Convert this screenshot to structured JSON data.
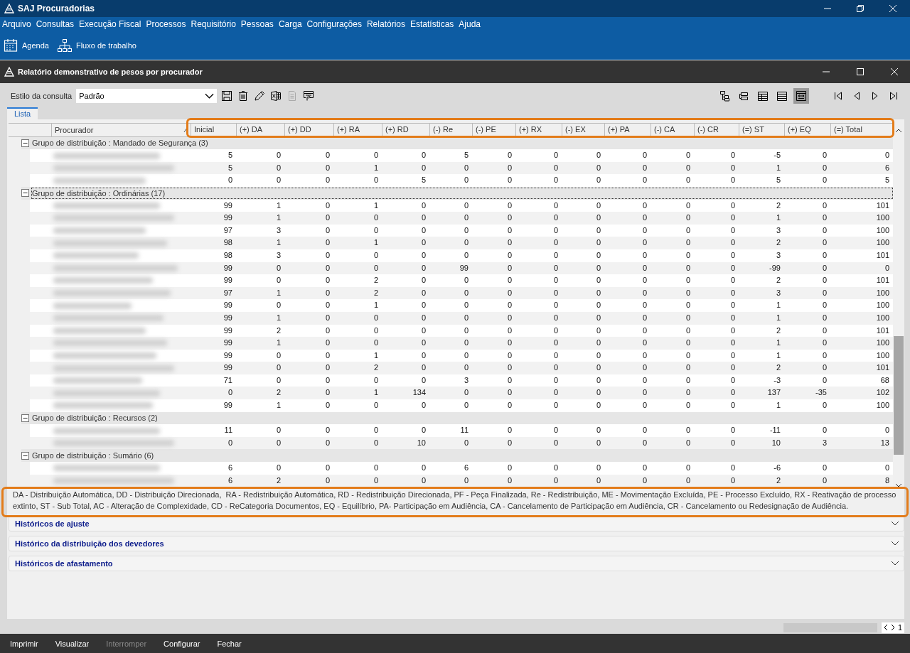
{
  "app": {
    "title": "SAJ Procuradorias"
  },
  "menu": [
    "Arquivo",
    "Consultas",
    "Execução Fiscal",
    "Processos",
    "Requisitório",
    "Pessoas",
    "Carga",
    "Configurações",
    "Relatórios",
    "Estatísticas",
    "Ajuda"
  ],
  "toolbar": [
    {
      "label": "Agenda",
      "kind": "calendar"
    },
    {
      "label": "Fluxo de trabalho",
      "kind": "flow"
    }
  ],
  "window": {
    "title": "Relatório demonstrativo de pesos por procurador"
  },
  "query": {
    "label": "Estilo da consulta",
    "value": "Padrão"
  },
  "query_tools": [
    {
      "kind": "save",
      "disabled": false
    },
    {
      "kind": "delete",
      "disabled": false
    },
    {
      "kind": "edit",
      "disabled": false
    },
    {
      "kind": "excel",
      "disabled": false
    },
    {
      "kind": "copy",
      "disabled": true
    },
    {
      "kind": "export",
      "disabled": false
    }
  ],
  "view_buttons": [
    {
      "kind": "tree",
      "selected": false
    },
    {
      "kind": "group",
      "selected": false
    },
    {
      "kind": "grid",
      "selected": false
    },
    {
      "kind": "list",
      "selected": false
    },
    {
      "kind": "fit",
      "selected": true
    }
  ],
  "nav_buttons": [
    {
      "kind": "first"
    },
    {
      "kind": "prev"
    },
    {
      "kind": "next"
    },
    {
      "kind": "last"
    }
  ],
  "tabs": [
    {
      "label": "Lista",
      "selected": true
    }
  ],
  "table": {
    "columns": [
      "Procurador",
      "Inicial",
      "(+) DA",
      "(+) DD",
      "(+) RA",
      "(+) RD",
      "(-) Re",
      "(-) PE",
      "(+) RX",
      "(-) EX",
      "(+) PA",
      "(-) CA",
      "(-) CR",
      "(=) ST",
      "(+) EQ",
      "(=) Total"
    ],
    "groups": [
      {
        "title": "Grupo de distribuição : Mandado de Segurança (3)",
        "expanded": true,
        "selected": false,
        "rows": [
          [
            "5",
            "0",
            "0",
            "0",
            "0",
            "5",
            "0",
            "0",
            "0",
            "0",
            "0",
            "0",
            "-5",
            "0",
            "0"
          ],
          [
            "5",
            "0",
            "0",
            "1",
            "0",
            "0",
            "0",
            "0",
            "0",
            "0",
            "0",
            "0",
            "1",
            "0",
            "6"
          ],
          [
            "0",
            "0",
            "0",
            "0",
            "5",
            "0",
            "0",
            "0",
            "0",
            "0",
            "0",
            "0",
            "5",
            "0",
            "5"
          ]
        ]
      },
      {
        "title": "Grupo de distribuição : Ordinárias (17)",
        "expanded": true,
        "selected": true,
        "rows": [
          [
            "99",
            "1",
            "0",
            "1",
            "0",
            "0",
            "0",
            "0",
            "0",
            "0",
            "0",
            "0",
            "2",
            "0",
            "101"
          ],
          [
            "99",
            "1",
            "0",
            "0",
            "0",
            "0",
            "0",
            "0",
            "0",
            "0",
            "0",
            "0",
            "1",
            "0",
            "100"
          ],
          [
            "97",
            "3",
            "0",
            "0",
            "0",
            "0",
            "0",
            "0",
            "0",
            "0",
            "0",
            "0",
            "3",
            "0",
            "100"
          ],
          [
            "98",
            "1",
            "0",
            "1",
            "0",
            "0",
            "0",
            "0",
            "0",
            "0",
            "0",
            "0",
            "2",
            "0",
            "100"
          ],
          [
            "98",
            "3",
            "0",
            "0",
            "0",
            "0",
            "0",
            "0",
            "0",
            "0",
            "0",
            "0",
            "3",
            "0",
            "101"
          ],
          [
            "99",
            "0",
            "0",
            "0",
            "0",
            "99",
            "0",
            "0",
            "0",
            "0",
            "0",
            "0",
            "-99",
            "0",
            "0"
          ],
          [
            "99",
            "0",
            "0",
            "2",
            "0",
            "0",
            "0",
            "0",
            "0",
            "0",
            "0",
            "0",
            "2",
            "0",
            "101"
          ],
          [
            "97",
            "1",
            "0",
            "2",
            "0",
            "0",
            "0",
            "0",
            "0",
            "0",
            "0",
            "0",
            "3",
            "0",
            "100"
          ],
          [
            "99",
            "0",
            "0",
            "1",
            "0",
            "0",
            "0",
            "0",
            "0",
            "0",
            "0",
            "0",
            "1",
            "0",
            "100"
          ],
          [
            "99",
            "1",
            "0",
            "0",
            "0",
            "0",
            "0",
            "0",
            "0",
            "0",
            "0",
            "0",
            "1",
            "0",
            "100"
          ],
          [
            "99",
            "2",
            "0",
            "0",
            "0",
            "0",
            "0",
            "0",
            "0",
            "0",
            "0",
            "0",
            "2",
            "0",
            "101"
          ],
          [
            "99",
            "1",
            "0",
            "0",
            "0",
            "0",
            "0",
            "0",
            "0",
            "0",
            "0",
            "0",
            "1",
            "0",
            "100"
          ],
          [
            "99",
            "0",
            "0",
            "1",
            "0",
            "0",
            "0",
            "0",
            "0",
            "0",
            "0",
            "0",
            "1",
            "0",
            "100"
          ],
          [
            "99",
            "0",
            "0",
            "2",
            "0",
            "0",
            "0",
            "0",
            "0",
            "0",
            "0",
            "0",
            "2",
            "0",
            "101"
          ],
          [
            "71",
            "0",
            "0",
            "0",
            "0",
            "3",
            "0",
            "0",
            "0",
            "0",
            "0",
            "0",
            "-3",
            "0",
            "68"
          ],
          [
            "0",
            "2",
            "0",
            "1",
            "134",
            "0",
            "0",
            "0",
            "0",
            "0",
            "0",
            "0",
            "137",
            "-35",
            "102"
          ],
          [
            "99",
            "1",
            "0",
            "0",
            "0",
            "0",
            "0",
            "0",
            "0",
            "0",
            "0",
            "0",
            "1",
            "0",
            "100"
          ]
        ]
      },
      {
        "title": "Grupo de distribuição : Recursos (2)",
        "expanded": true,
        "selected": false,
        "rows": [
          [
            "11",
            "0",
            "0",
            "0",
            "0",
            "11",
            "0",
            "0",
            "0",
            "0",
            "0",
            "0",
            "-11",
            "0",
            "0"
          ],
          [
            "0",
            "0",
            "0",
            "0",
            "10",
            "0",
            "0",
            "0",
            "0",
            "0",
            "0",
            "0",
            "10",
            "3",
            "13"
          ]
        ]
      },
      {
        "title": "Grupo de distribuição : Sumário (6)",
        "expanded": true,
        "selected": false,
        "rows": [
          [
            "6",
            "0",
            "0",
            "0",
            "0",
            "6",
            "0",
            "0",
            "0",
            "0",
            "0",
            "0",
            "-6",
            "0",
            "0"
          ],
          [
            "6",
            "2",
            "0",
            "0",
            "0",
            "0",
            "0",
            "0",
            "0",
            "0",
            "0",
            "0",
            "2",
            "0",
            "8"
          ]
        ]
      }
    ]
  },
  "legend": "DA - Distribuição Automática, DD - Distribuição Direcionada,  RA - Redistribuição Automática, RD - Redistribuição Direcionada, PF - Peça Finalizada, Re - Redistribuição, ME - Movimentação Excluída, PE - Processo Excluído, RX - Reativação de processo extinto, ST - Sub Total, AC - Alteração de Complexidade, CD - ReCategoria Documentos, EQ - Equilíbrio, PA- Participação em Audiência, CA - Cancelamento de Participação em Audiência, CR - Cancelamento ou Redesignação de Audiência.",
  "sections": [
    {
      "title": "Históricos de ajuste",
      "expanded": false
    },
    {
      "title": "Histórico da distribuição dos devedores",
      "expanded": false
    },
    {
      "title": "Históricos de afastamento",
      "expanded": false
    }
  ],
  "pager": {
    "page": "1"
  },
  "actions": [
    {
      "label": "Imprimir",
      "disabled": false
    },
    {
      "label": "Visualizar",
      "disabled": false
    },
    {
      "label": "Interromper",
      "disabled": true
    },
    {
      "label": "Configurar",
      "disabled": false
    },
    {
      "label": "Fechar",
      "disabled": false
    }
  ],
  "highlights": {
    "header": true,
    "legend": true
  }
}
